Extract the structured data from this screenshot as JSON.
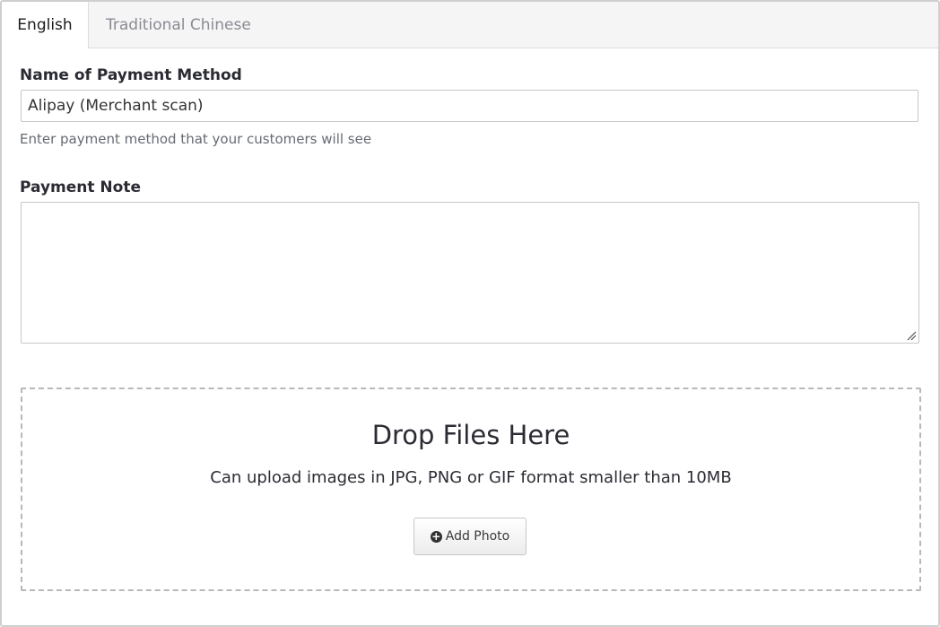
{
  "tabs": [
    {
      "label": "English",
      "active": true
    },
    {
      "label": "Traditional Chinese",
      "active": false
    }
  ],
  "payment_method": {
    "label": "Name of Payment Method",
    "value": "Alipay (Merchant scan)",
    "help": "Enter payment method that your customers will see"
  },
  "payment_note": {
    "label": "Payment Note",
    "value": ""
  },
  "dropzone": {
    "title": "Drop Files Here",
    "subtitle": "Can upload images in JPG, PNG or GIF format smaller than 10MB",
    "button_label": "Add Photo",
    "button_icon": "plus-circle-icon"
  }
}
